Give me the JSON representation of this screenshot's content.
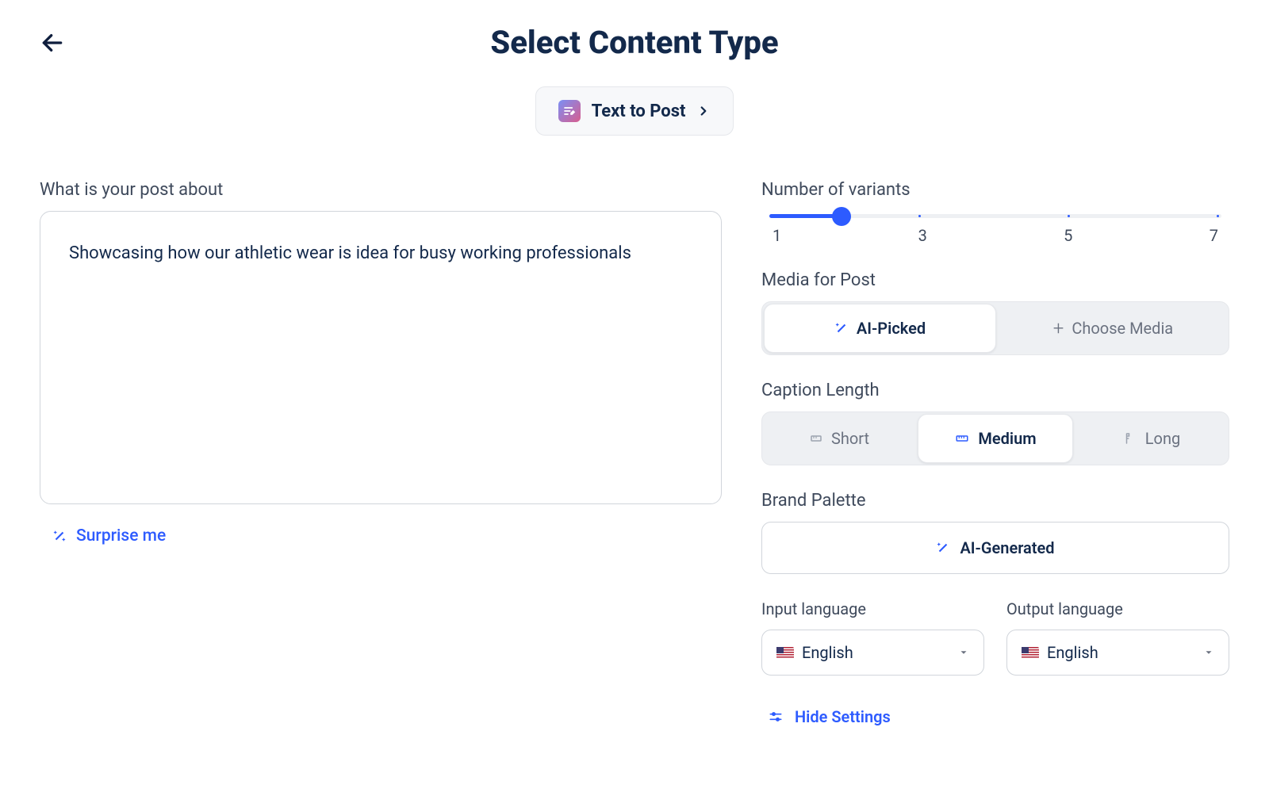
{
  "header": {
    "title": "Select Content Type",
    "content_type_label": "Text to Post"
  },
  "post_input": {
    "label": "What is your post about",
    "value": "Showcasing how our athletic wear is idea for busy working professionals",
    "surprise_label": "Surprise me"
  },
  "settings": {
    "variants": {
      "label": "Number of variants",
      "ticks": [
        "1",
        "3",
        "5",
        "7"
      ]
    },
    "media": {
      "label": "Media for Post",
      "ai_picked": "AI-Picked",
      "choose_media": "Choose Media"
    },
    "caption": {
      "label": "Caption Length",
      "short": "Short",
      "medium": "Medium",
      "long": "Long"
    },
    "palette": {
      "label": "Brand Palette",
      "ai_generated": "AI-Generated"
    },
    "languages": {
      "input_label": "Input language",
      "output_label": "Output language",
      "input_value": "English",
      "output_value": "English"
    },
    "hide_settings": "Hide Settings"
  }
}
